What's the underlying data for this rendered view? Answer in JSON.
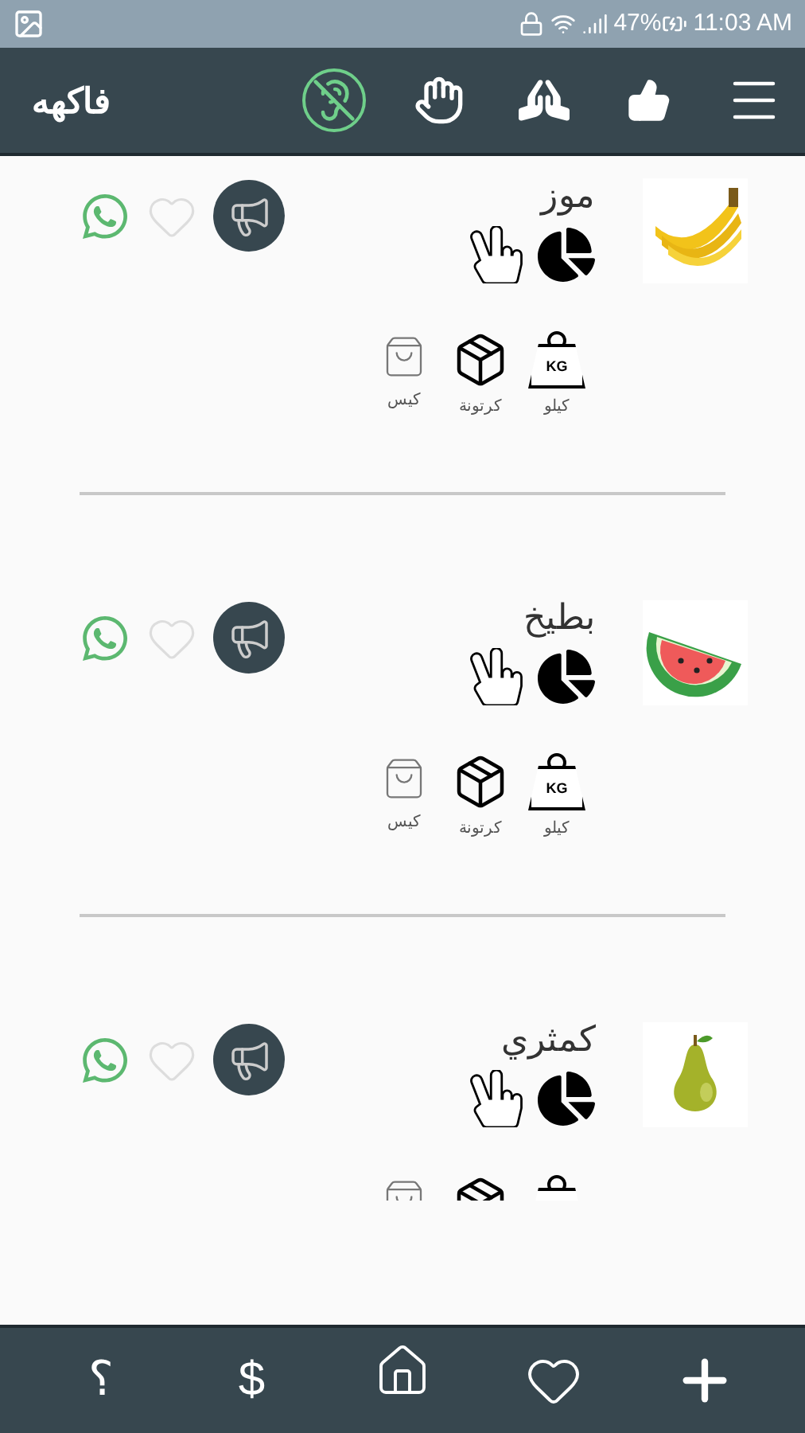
{
  "status_bar": {
    "battery": "47%",
    "time": "11:03 AM"
  },
  "header": {
    "title": "فاكهه",
    "actions": [
      {
        "kind": "ear-off"
      },
      {
        "kind": "hand"
      },
      {
        "kind": "pray"
      },
      {
        "kind": "like"
      },
      {
        "kind": "menu"
      }
    ]
  },
  "items": [
    {
      "name": "موز",
      "units": [
        {
          "kind": "kilo",
          "badge": "KG",
          "label": "كيلو"
        },
        {
          "kind": "carton",
          "label": "كرتونة"
        },
        {
          "kind": "bag",
          "label": "كيس"
        }
      ]
    },
    {
      "name": "بطيخ",
      "units": [
        {
          "kind": "kilo",
          "badge": "KG",
          "label": "كيلو"
        },
        {
          "kind": "carton",
          "label": "كرتونة"
        },
        {
          "kind": "bag",
          "label": "كيس"
        }
      ]
    },
    {
      "name": "كمثري",
      "units": [
        {
          "kind": "kilo"
        },
        {
          "kind": "carton"
        },
        {
          "kind": "bag"
        }
      ]
    }
  ],
  "bottom_nav": [
    {
      "kind": "plus"
    },
    {
      "kind": "heart"
    },
    {
      "kind": "home"
    },
    {
      "kind": "text",
      "label": "$"
    },
    {
      "kind": "text",
      "label": "؟"
    }
  ]
}
